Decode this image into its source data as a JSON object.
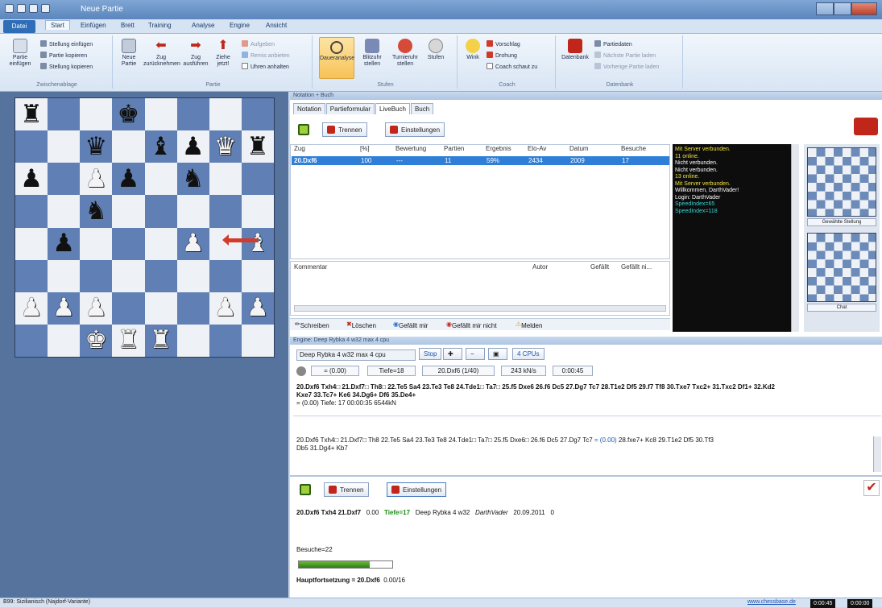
{
  "window": {
    "title": "Neue Partie"
  },
  "menu": {
    "file": "Datei",
    "items": [
      "Start",
      "Einfügen",
      "Brett",
      "Training",
      "Analyse",
      "Engine",
      "Ansicht"
    ]
  },
  "ribbon": {
    "clipboard": {
      "paste": "Partie einfügen",
      "small": [
        "Stellung einfügen",
        "Partie kopieren",
        "Stellung kopieren"
      ],
      "label": "Zwischenablage"
    },
    "game": {
      "new": "Neue Partie",
      "undo": "Zug zurücknehmen",
      "redo": "Zug ausführen",
      "move_now": "Ziehe jetzt!",
      "small": [
        "Aufgeben",
        "Remis anbieten",
        "Uhren anhalten"
      ],
      "label": "Partie"
    },
    "levels": {
      "btns": [
        "Daueranalyse",
        "Blitzuhr stellen",
        "Turnieruhr stellen",
        "Stufen"
      ],
      "label": "Stufen"
    },
    "coach": {
      "hint": "Wink",
      "small": [
        "Vorschlag",
        "Drohung",
        "Coach schaut zu"
      ],
      "label": "Coach"
    },
    "database": {
      "btn": "Datenbank",
      "small": [
        "Partiedaten",
        "Nächste Partie laden",
        "Vorherige Partie laden"
      ],
      "label": "Datenbank"
    }
  },
  "board": {
    "rows": [
      [
        "br",
        "",
        "",
        "bk",
        "",
        "",
        "",
        ""
      ],
      [
        "",
        "",
        "bq",
        "",
        "bb",
        "bp",
        "wq",
        "br"
      ],
      [
        "bp",
        "",
        "wp",
        "bp",
        "",
        "bn",
        "",
        ""
      ],
      [
        "",
        "",
        "bn",
        "",
        "",
        "",
        "",
        ""
      ],
      [
        "",
        "bp",
        "",
        "",
        "",
        "wp",
        "",
        "wb"
      ],
      [
        "",
        "",
        "",
        "",
        "",
        "",
        "",
        ""
      ],
      [
        "wp",
        "wp",
        "wp",
        "",
        "",
        "",
        "wp",
        "wp"
      ],
      [
        "",
        "",
        "wk",
        "wr",
        "wr",
        "",
        "",
        ""
      ]
    ]
  },
  "notation_panel": {
    "header": "Notation + Buch",
    "tabs": [
      "Notation",
      "Partieformular",
      "LiveBuch",
      "Buch"
    ],
    "disconnect": "Trennen",
    "settings": "Einstellungen",
    "columns": [
      "Zug",
      "[%]",
      "Bewertung",
      "Partien",
      "Ergebnis",
      "Elo-Av",
      "Datum",
      "Besuche"
    ],
    "row": [
      "20.Dxf6",
      "100",
      "---",
      "11",
      "59%",
      "2434",
      "2009",
      "17"
    ],
    "comment_cols": [
      "Kommentar",
      "Autor",
      "Gefällt",
      "Gefällt ni..."
    ],
    "toolbar": [
      "Schreiben",
      "Löschen",
      "Gefällt mir",
      "Gefällt mir nicht",
      "Melden"
    ]
  },
  "chat": [
    {
      "t": "Mit Server verbunden.",
      "c": "#f2e23a"
    },
    {
      "t": "11 online.",
      "c": "#f2e23a"
    },
    {
      "t": "Nicht verbunden.",
      "c": "#ffffff"
    },
    {
      "t": "Nicht verbunden.",
      "c": "#ffffff"
    },
    {
      "t": "13 online.",
      "c": "#f2e23a"
    },
    {
      "t": "Mit Server verbunden.",
      "c": "#f2e23a"
    },
    {
      "t": "Willkommen, DarthVader!",
      "c": "#ffffff"
    },
    {
      "t": "Login: DarthVader",
      "c": "#ffffff"
    },
    {
      "t": "SpeedIndex=65",
      "c": "#35d6d6"
    },
    {
      "t": "SpeedIndex=118",
      "c": "#35d6d6"
    }
  ],
  "thumbs": [
    "Gewählte Stellung",
    "Chat"
  ],
  "engine": {
    "header": "Engine: Deep Rybka 4 w32 max 4 cpu",
    "name": "Deep Rybka 4 w32 max 4 cpu",
    "stop": "Stop",
    "cpus": "4 CPUs",
    "eval": "= (0.00)",
    "depth": "Tiefe=18",
    "move": "20.Dxf6 (1/40)",
    "speed": "243 kN/s",
    "time": "0:00:45",
    "line1": "20.Dxf6 Txh4□ 21.Dxf7□ Th8□ 22.Te5 Sa4 23.Te3 Te8 24.Tde1□ Ta7□ 25.f5 Dxe6 26.f6 Dc5 27.Dg7 Tc7 28.T1e2 Df5 29.f7 Tf8 30.Txe7 Txc2+ 31.Txc2 Df1+ 32.Kd2",
    "line1b": "Kxe7 33.Tc7+ Ke6 34.Dg6+ Df6 35.De4+",
    "line1c": "= (0.00)   Tiefe: 17   00:00:35   6544kN",
    "line2": "20.Dxf6 Txh4□ 21.Dxf7□ Th8 22.Te5 Sa4 23.Te3 Te8 24.Tde1□ Ta7□ 25.f5 Dxe6□ 26.f6 Dc5 27.Dg7 Tc7",
    "line2_eval": "= (0.00)",
    "line2_tail": "28.fxe7+ Kc8 29.T1e2 Df5 30.Tf3",
    "line2b": "Db5 31.Dg4+ Kb7"
  },
  "bottom": {
    "disconnect": "Trennen",
    "settings": "Einstellungen",
    "line": "20.Dxf6 Txh4 21.Dxf7",
    "score": "0.00",
    "depth": "Tiefe=17",
    "engine": "Deep Rybka 4 w32",
    "user": "DarthVader",
    "date": "20.09.2011",
    "zero": "0",
    "visits": "Besuche=22",
    "progress": 0.76,
    "main": "Hauptfortsetzung = 20.Dxf6",
    "main_tail": "0.00/16"
  },
  "status": {
    "left": "B99: Sizilianisch (Najdorf-Variante)",
    "site": "www.chessbase.de",
    "c1": "0:00:45",
    "c2": "0:00:00"
  }
}
